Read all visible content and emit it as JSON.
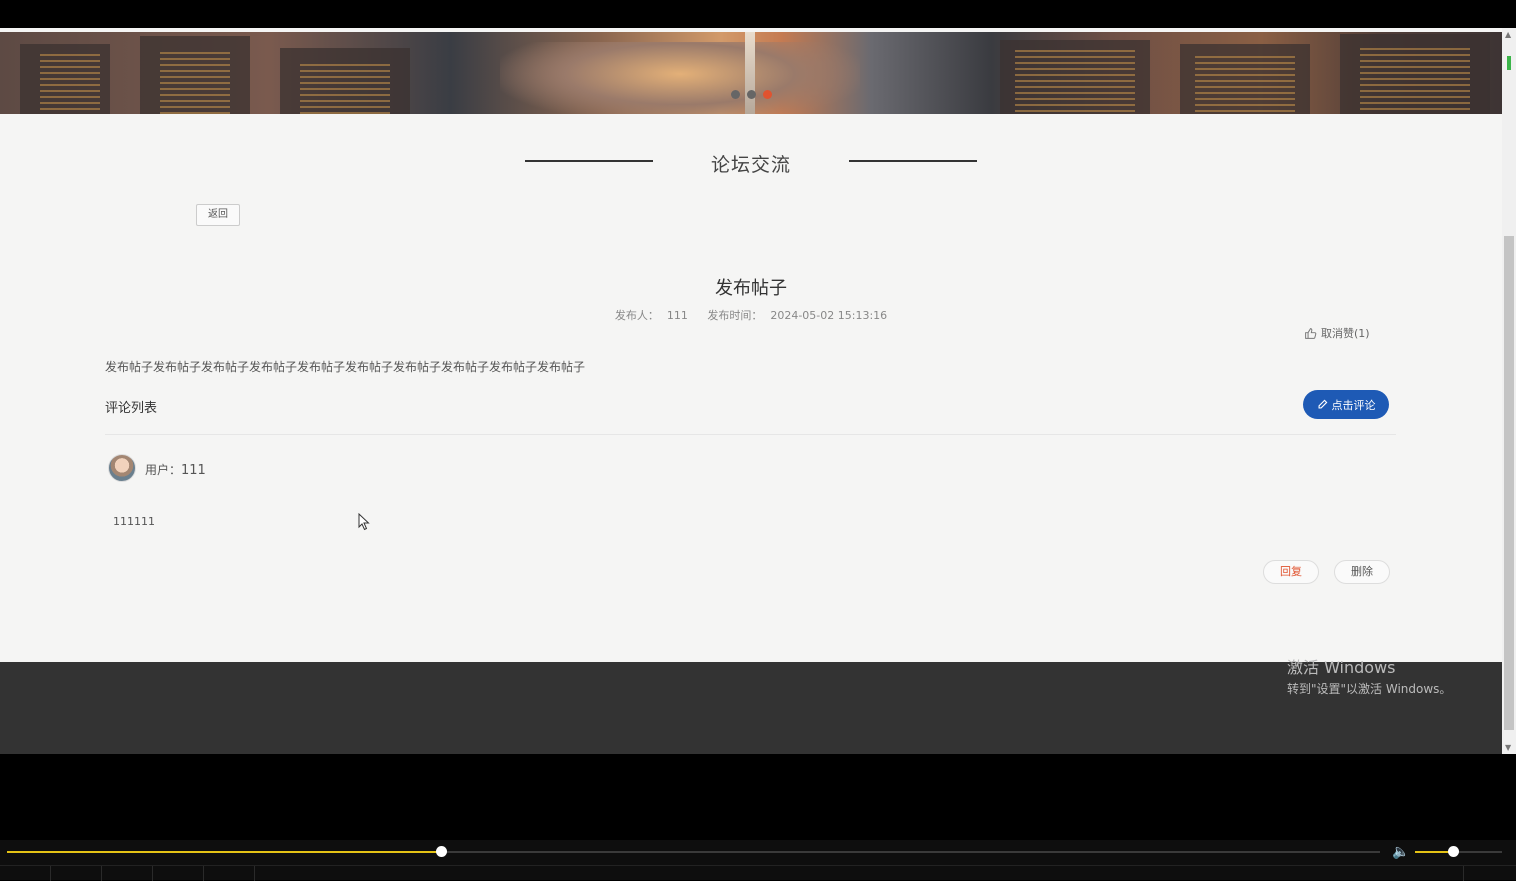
{
  "section": {
    "title": "论坛交流"
  },
  "nav": {
    "back_label": "返回"
  },
  "post": {
    "title": "发布帖子",
    "author_label": "发布人：",
    "author": "111",
    "time_label": "发布时间：",
    "time": "2024-05-02 15:13:16",
    "like_label": "取消赞(1)",
    "content": "发布帖子发布帖子发布帖子发布帖子发布帖子发布帖子发布帖子发布帖子发布帖子发布帖子"
  },
  "comments": {
    "header": "评论列表",
    "comment_button": "点击评论",
    "items": [
      {
        "user_label": "用户：",
        "user": "111",
        "text": "111111",
        "reply_label": "回复",
        "delete_label": "删除"
      }
    ]
  },
  "watermark": {
    "line1": "激活 Windows",
    "line2": "转到\"设置\"以激活 Windows。"
  },
  "player": {
    "progress": 0.316,
    "volume": 0.44
  },
  "carousel": {
    "active_index": 2,
    "count": 3
  },
  "colors": {
    "accent_blue": "#1e5ab5",
    "reply_red": "#e0532f",
    "seek_yellow": "#e4c215"
  }
}
